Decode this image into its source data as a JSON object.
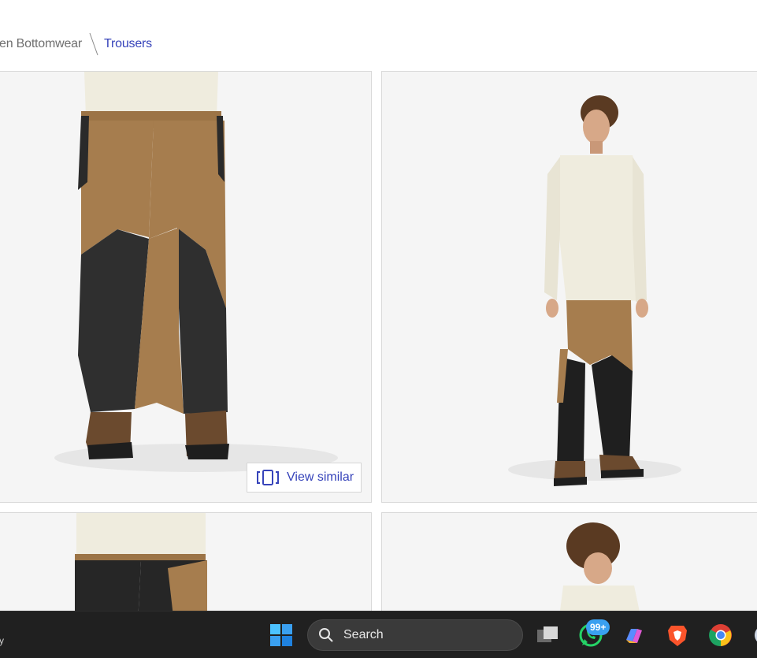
{
  "breadcrumb": {
    "previous": "en Bottomwear",
    "current": "Trousers"
  },
  "products": {
    "view_similar_label": "View similar",
    "view_similar_icon": "view-similar-icon"
  },
  "taskbar": {
    "left_text": "y",
    "search_label": "Search",
    "whatsapp_badge": "99+",
    "icons": [
      "windows-start-icon",
      "search-icon",
      "task-view-icon",
      "whatsapp-icon",
      "copilot-icon",
      "brave-icon",
      "chrome-icon"
    ]
  },
  "colors": {
    "accent": "#3643ba",
    "taskbar_bg": "#202020",
    "card_bg": "#f5f5f5"
  }
}
